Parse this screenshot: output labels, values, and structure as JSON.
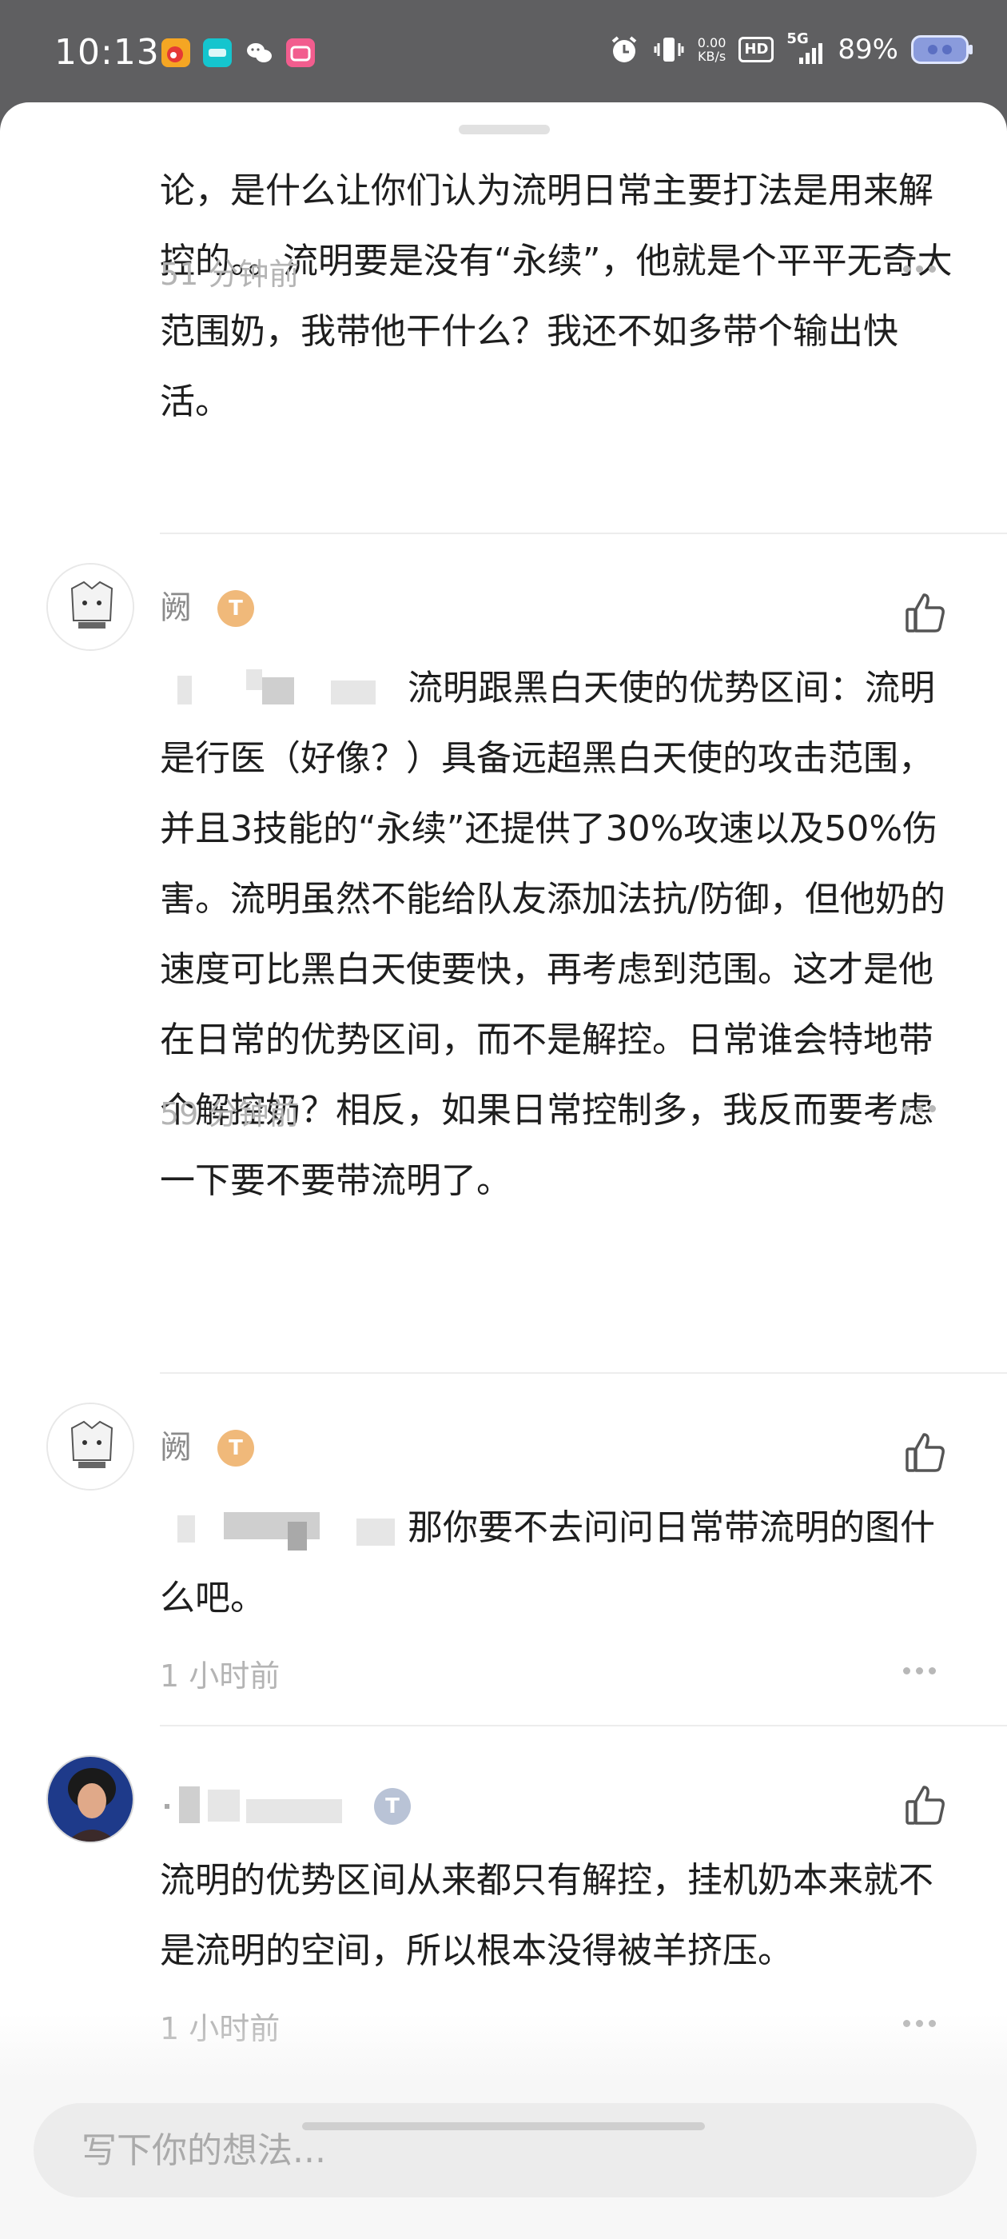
{
  "status_bar": {
    "time": "10:13",
    "net_speed_value": "0.00",
    "net_speed_unit": "KB/s",
    "hd_label": "HD",
    "network": "5G",
    "battery": "89%"
  },
  "comments": [
    {
      "text": "论，是什么让你们认为流明日常主要打法是用来解控的。。流明要是没有“永续”，他就是个平平无奇大范围奶，我带他干什么？我还不如多带个输出快活。",
      "time": "51 分钟前"
    },
    {
      "username": "阙",
      "badge": "T",
      "text": "流明跟黑白天使的优势区间：流明是行医（好像？）具备远超黑白天使的攻击范围，并且3技能的“永续”还提供了30%攻速以及50%伤害。流明虽然不能给队友添加法抗/防御，但他奶的速度可比黑白天使要快，再考虑到范围。这才是他在日常的优势区间，而不是解控。日常谁会特地带个解控奶？相反，如果日常控制多，我反而要考虑一下要不要带流明了。",
      "time": "59 分钟前"
    },
    {
      "username": "阙",
      "badge": "T",
      "text": "那你要不去问问日常带流明的图什么吧。",
      "time": "1 小时前"
    },
    {
      "badge": "T",
      "text": "流明的优势区间从来都只有解控，挂机奶本来就不是流明的空间，所以根本没得被羊挤压。",
      "time": "1 小时前"
    }
  ],
  "composer": {
    "placeholder": "写下你的想法..."
  },
  "colors": {
    "sheet_bg": "#ffffff",
    "status_bg": "#5f5f61",
    "meta_text": "#b4b4b4",
    "badge_gold": "#f0b97a",
    "badge_silver": "#b9c3d6"
  }
}
